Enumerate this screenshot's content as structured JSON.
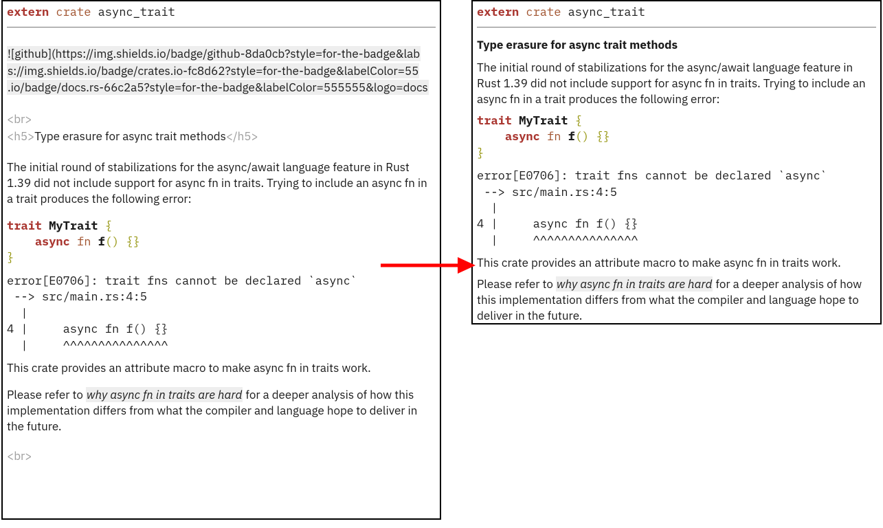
{
  "header_code": {
    "extern": "extern",
    "crate": "crate",
    "name": " async_trait"
  },
  "badges": {
    "line1": "![github](https://img.shields.io/badge/github-8da0cb?style=for-the-badge&lab",
    "line2": "s://img.shields.io/badge/crates.io-fc8d62?style=for-the-badge&labelColor=55",
    "line3": ".io/badge/docs.rs-66c2a5?style=for-the-badge&labelColor=555555&logo=docs"
  },
  "br_tag": "<br>",
  "h5_open": "<h5>",
  "h5_close": "</h5>",
  "heading": "Type erasure for async trait methods",
  "intro": "The initial round of stabilizations for the async/await language feature in Rust 1.39 did not include support for async fn in traits. Trying to include an async fn in a trait produces the following error:",
  "trait_code": {
    "trait": "trait",
    "name": " MyTrait ",
    "lbrace": "{",
    "indent": "    ",
    "async": "async",
    "fn": " fn ",
    "fn_name": "f",
    "parens": "()",
    "sp": " ",
    "empty": "{}",
    "rbrace": "}"
  },
  "error_block": "error[E0706]: trait fns cannot be declared `async`\n --> src/main.rs:4:5\n  |\n4 |     async fn f() {}\n  |     ^^^^^^^^^^^^^^^",
  "outro1": "This crate provides an attribute macro to make async fn in traits work.",
  "outro2_pre": "Please refer to ",
  "outro2_link": "why async fn in traits are hard",
  "outro2_post": " for a deeper analysis of how this implementation differs from what the compiler and language hope to deliver in the future."
}
